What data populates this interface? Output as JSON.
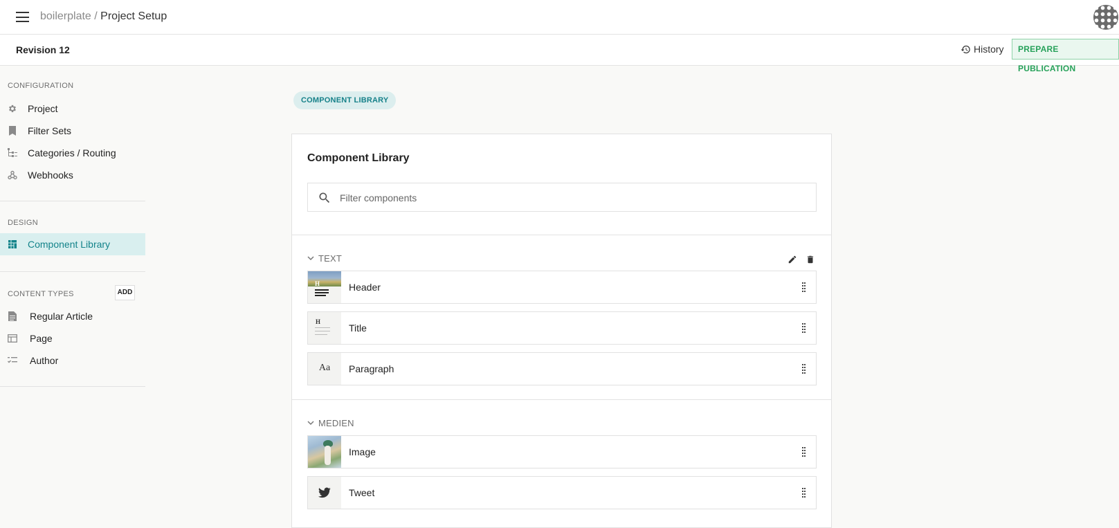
{
  "topbar": {
    "project": "boilerplate",
    "separator": " / ",
    "current": "Project Setup"
  },
  "subbar": {
    "revision": "Revision 12",
    "history_label": "History",
    "prepare_label": "PREPARE PUBLICATION"
  },
  "sidebar": {
    "configuration_label": "CONFIGURATION",
    "configuration_items": [
      {
        "label": "Project",
        "icon": "gear-icon"
      },
      {
        "label": "Filter Sets",
        "icon": "bookmark-icon"
      },
      {
        "label": "Categories / Routing",
        "icon": "tree-icon"
      },
      {
        "label": "Webhooks",
        "icon": "webhook-icon"
      }
    ],
    "design_label": "DESIGN",
    "design_items": [
      {
        "label": "Component Library",
        "icon": "grid-icon",
        "active": true
      }
    ],
    "content_types_label": "CONTENT TYPES",
    "add_label": "ADD",
    "content_types": [
      {
        "label": "Regular Article",
        "icon": "document-icon"
      },
      {
        "label": "Page",
        "icon": "page-icon"
      },
      {
        "label": "Author",
        "icon": "checklist-icon"
      }
    ]
  },
  "main": {
    "pill": "COMPONENT LIBRARY",
    "card_title": "Component Library",
    "search_placeholder": "Filter components",
    "groups": [
      {
        "name": "TEXT",
        "items": [
          "Header",
          "Title",
          "Paragraph"
        ]
      },
      {
        "name": "MEDIEN",
        "items": [
          "Image",
          "Tweet"
        ]
      }
    ],
    "thumb_text": {
      "title_glyph": "H",
      "paragraph_glyph": "Aa"
    }
  },
  "colors": {
    "accent": "#13838a",
    "accent_bg": "#d9efef",
    "publish_green": "#27a25a",
    "publish_bg": "#eaf7ef"
  }
}
